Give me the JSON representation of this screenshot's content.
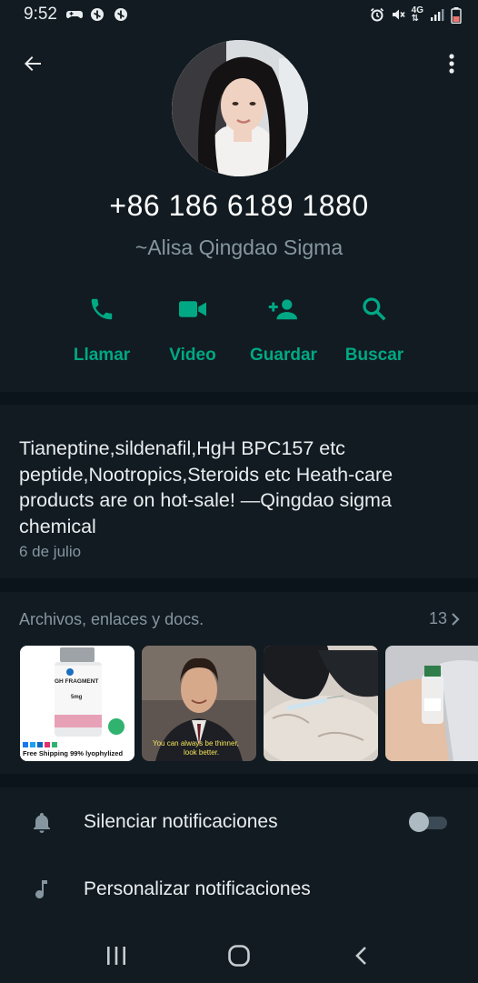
{
  "status_bar": {
    "time": "9:52",
    "network": "4G",
    "left_icons": [
      "game-controller-icon",
      "blocked-notification-icon",
      "blocked-notification-icon"
    ],
    "right_icons": [
      "alarm-icon",
      "mute-icon",
      "network-icon",
      "signal-icon",
      "battery-icon"
    ]
  },
  "contact": {
    "phone": "+86 186 6189 1880",
    "name": "~Alisa Qingdao Sigma"
  },
  "actions": [
    {
      "label": "Llamar",
      "icon": "phone-icon"
    },
    {
      "label": "Video",
      "icon": "video-camera-icon"
    },
    {
      "label": "Guardar",
      "icon": "add-contact-icon"
    },
    {
      "label": "Buscar",
      "icon": "search-icon"
    }
  ],
  "about": {
    "text": "Tianeptine,sildenafil,HgH BPC157 etc peptide,Nootropics,Steroids etc Heath-care products are on hot-sale! —Qingdao sigma chemical",
    "date": "6 de julio"
  },
  "media": {
    "title": "Archivos, enlaces y docs.",
    "count": "13",
    "thumbnails": [
      {
        "caption_1": "GH FRAGMENT",
        "caption_2": "5mg",
        "caption_3": "Free Shipping 99% lyophylized"
      },
      {
        "caption_1": "You can always be thinner,",
        "caption_2": "look better."
      },
      {},
      {}
    ]
  },
  "settings": {
    "mute_label": "Silenciar notificaciones",
    "custom_label": "Personalizar notificaciones",
    "mute_enabled": false
  },
  "colors": {
    "accent": "#00a884",
    "background": "#0b141a",
    "panel": "#111b21",
    "secondary_text": "#8696a0"
  }
}
